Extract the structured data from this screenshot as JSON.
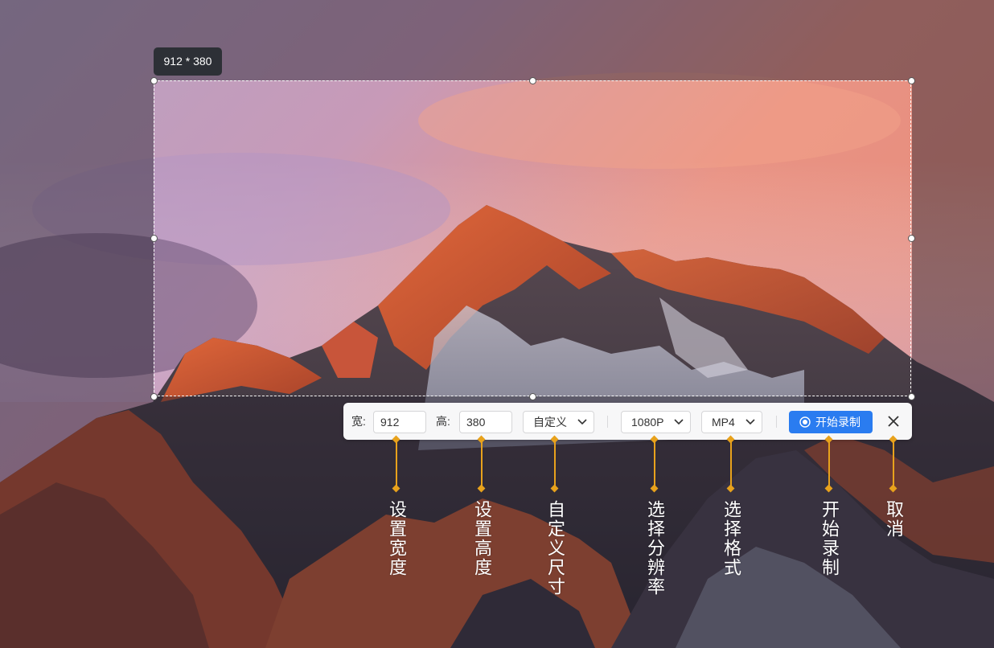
{
  "selection": {
    "size_label": "912 * 380"
  },
  "toolbar": {
    "width_label": "宽:",
    "width_value": "912",
    "height_label": "高:",
    "height_value": "380",
    "size_preset": "自定义",
    "resolution": "1080P",
    "format": "MP4",
    "record_label": "开始录制",
    "close_icon": "close-icon",
    "record_icon": "record-icon"
  },
  "annotations": {
    "set_width": "设置宽度",
    "set_height": "设置高度",
    "custom_size": "自定义尺寸",
    "select_resolution": "选择分辨率",
    "select_format": "选择格式",
    "start_recording": "开始录制",
    "cancel": "取消"
  },
  "colors": {
    "accent": "#2a7cf0",
    "annotation": "#e8a21c",
    "toolbar_bg": "#f7f7f8",
    "size_tag_bg": "#2d3036"
  }
}
